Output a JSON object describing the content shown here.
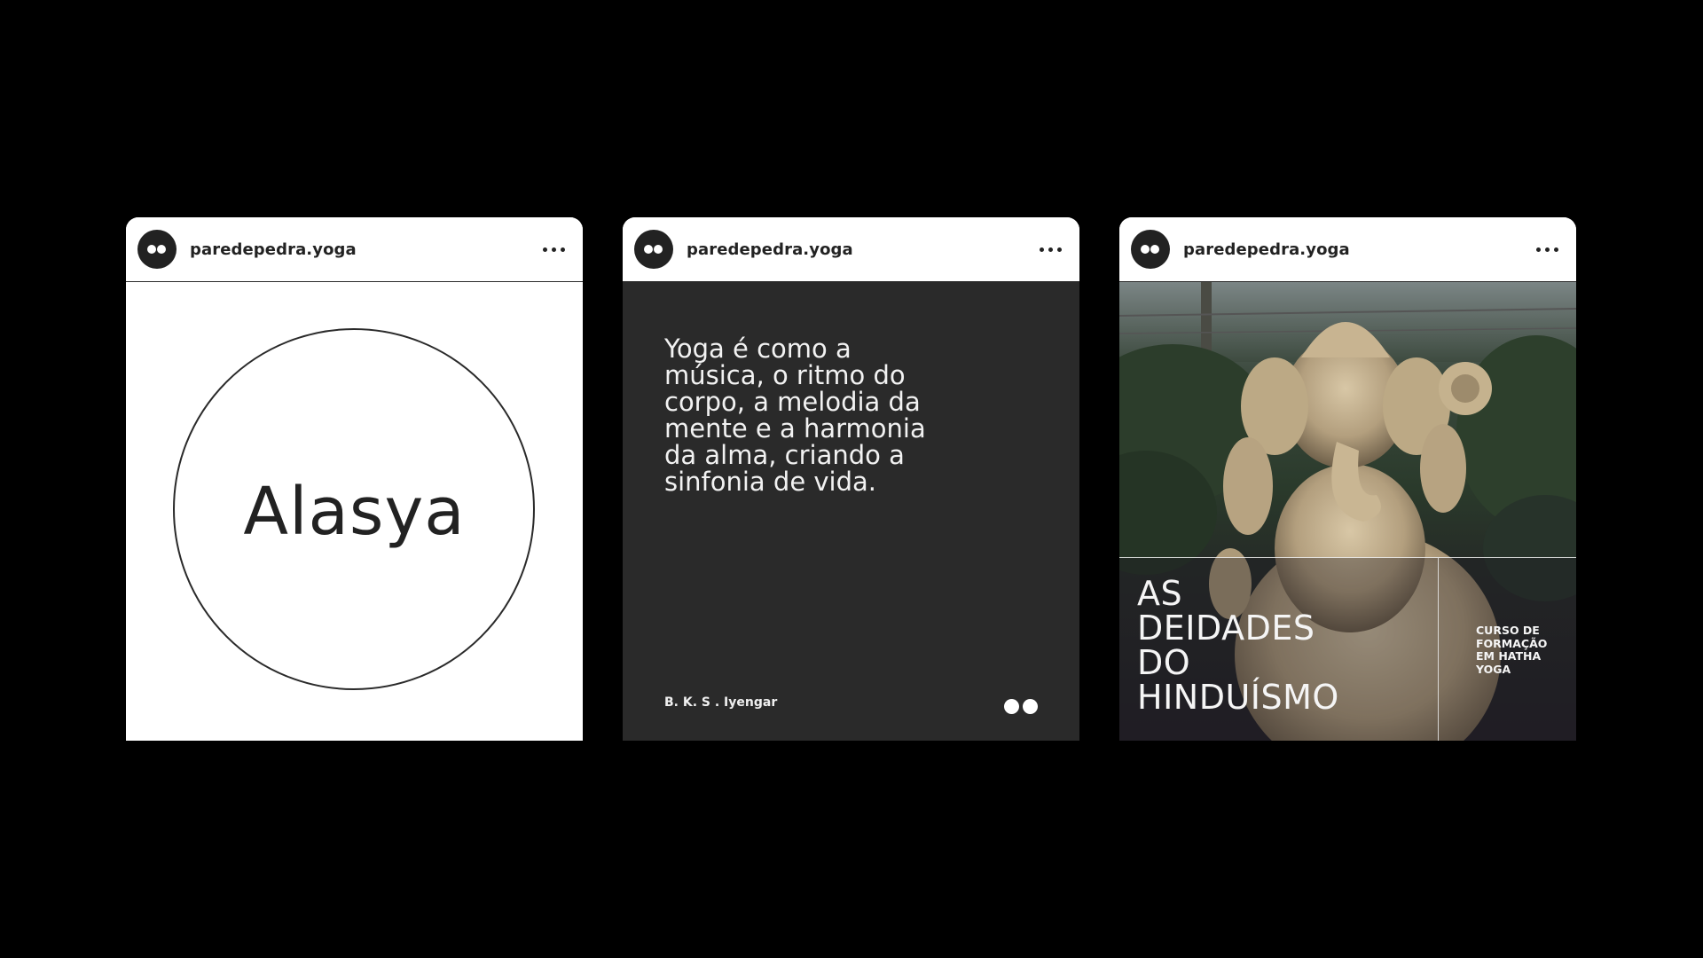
{
  "posts": [
    {
      "username": "paredepedra.yoga",
      "title": "Alasya"
    },
    {
      "username": "paredepedra.yoga",
      "quote": "Yoga é como a\nmúsica, o ritmo do\ncorpo, a melodia da\nmente e a harmonia\nda alma, criando a\nsinfonia de vida.",
      "author": "B. K. S . Iyengar"
    },
    {
      "username": "paredepedra.yoga",
      "headline": "AS\nDEIDADES\nDO\nHINDUÍSMO",
      "course": "CURSO DE\nFORMAÇÃO\nEM HATHA\nYOGA"
    }
  ],
  "icons": {
    "avatar": "two-dots-logo-icon",
    "menu": "more-horizontal-icon"
  },
  "colors": {
    "background": "#000000",
    "card_light": "#ffffff",
    "card_dark": "#2a2a2a",
    "text_dark": "#222222",
    "text_light": "#f2f2f2"
  }
}
